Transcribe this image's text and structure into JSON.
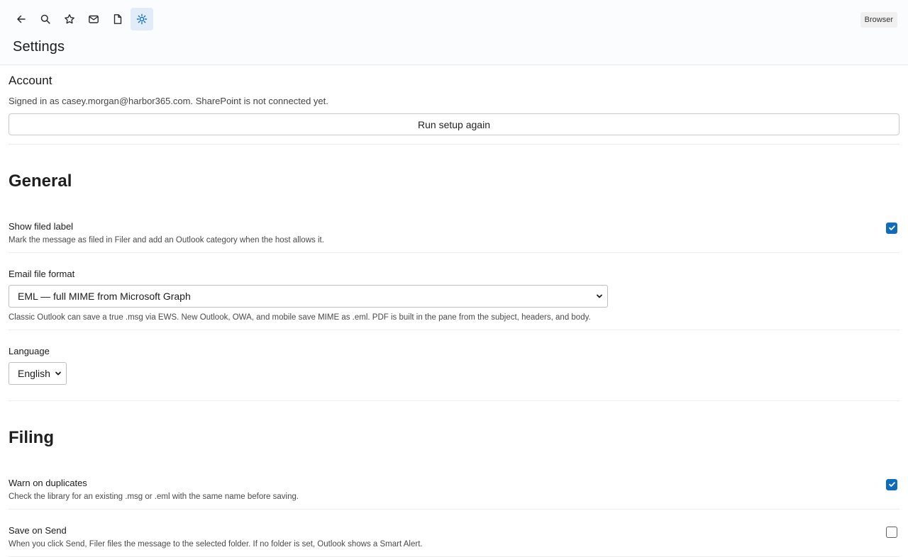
{
  "toolbar": {
    "items": [
      {
        "icon": "back-arrow-icon"
      },
      {
        "icon": "search-icon"
      },
      {
        "icon": "star-icon"
      },
      {
        "icon": "mail-icon"
      },
      {
        "icon": "document-icon"
      },
      {
        "icon": "settings-sun-icon",
        "active": true
      }
    ]
  },
  "host_badge": "Browser",
  "page_title": "Settings",
  "account": {
    "heading": "Account",
    "status": "Signed in as casey.morgan@harbor365.com. SharePoint is not connected yet.",
    "setup_button": "Run setup again"
  },
  "general": {
    "heading": "General",
    "show_filed_label": {
      "label": "Show filed label",
      "desc": "Mark the message as filed in Filer and add an Outlook category when the host allows it.",
      "checked": true
    },
    "email_format": {
      "label": "Email file format",
      "selected": "EML — full MIME from Microsoft Graph",
      "desc": "Classic Outlook can save a true .msg via EWS. New Outlook, OWA, and mobile save MIME as .eml. PDF is built in the pane from the subject, headers, and body."
    },
    "language": {
      "label": "Language",
      "selected": "English"
    }
  },
  "filing": {
    "heading": "Filing",
    "warn_duplicates": {
      "label": "Warn on duplicates",
      "desc": "Check the library for an existing .msg or .eml with the same name before saving.",
      "checked": true
    },
    "save_on_send": {
      "label": "Save on Send",
      "desc": "When you click Send, Filer files the message to the selected folder. If no folder is set, Outlook shows a Smart Alert.",
      "checked": false
    }
  },
  "colors": {
    "accent": "#0f6cbd",
    "active_bg": "#e1ecf8"
  }
}
